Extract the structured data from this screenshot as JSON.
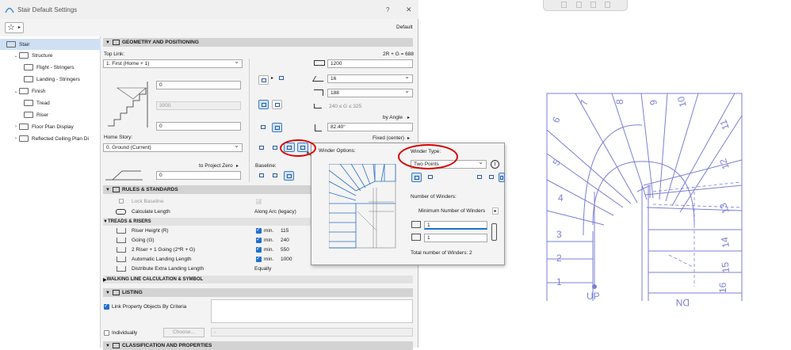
{
  "window": {
    "title": "Stair Default Settings",
    "help": "?",
    "close": "✕",
    "preset": "Default"
  },
  "tree": [
    {
      "label": "Stair",
      "level": 0,
      "selected": true,
      "arrow": ""
    },
    {
      "label": "Structure",
      "level": 1,
      "arrow": "v"
    },
    {
      "label": "Flight - Stringers",
      "level": 2,
      "arrow": ""
    },
    {
      "label": "Landing - Stringers",
      "level": 2,
      "arrow": ""
    },
    {
      "label": "Finish",
      "level": 1,
      "arrow": "v"
    },
    {
      "label": "Tread",
      "level": 2,
      "arrow": ""
    },
    {
      "label": "Riser",
      "level": 2,
      "arrow": ""
    },
    {
      "label": "Floor Plan Display",
      "level": 1,
      "arrow": ">"
    },
    {
      "label": "Reflected Ceiling Plan Di",
      "level": 1,
      "arrow": ">"
    }
  ],
  "geometry": {
    "header": "GEOMETRY AND POSITIONING",
    "formula": "2R + G = 688",
    "top_link_label": "Top Link:",
    "top_link_value": "1. First (Home + 1)",
    "offset_top": "0",
    "height": "3000",
    "offset_bottom": "0",
    "home_story_label": "Home Story:",
    "home_story_value": "0. Ground (Current)",
    "to_project_zero": "to Project Zero",
    "project_zero_value": "0",
    "width": "1200",
    "risers": "16",
    "riser_height": "188",
    "going_range": "240 ≤ G ≤ 325",
    "by_angle": "by Angle",
    "angle": "82.40°",
    "fixed_center": "Fixed (center)",
    "baseline_label": "Baseline:"
  },
  "winder_popup": {
    "options_label": "Winder Options:",
    "type_label": "Winder Type:",
    "type_value": "Two Points",
    "number_label": "Number of Winders:",
    "minimum_label": "Minimum Number of Winders",
    "value1": "1",
    "value2": "1",
    "total": "Total number of Winders: 2"
  },
  "rules": {
    "header": "RULES & STANDARDS",
    "lock_baseline": "Lock Baseline",
    "calculate_length": "Calculate Length",
    "calculate_length_value": "Along Arc (legacy)",
    "treads_header": "TREADS & RISERS",
    "rows": [
      {
        "label": "Riser Height (R)",
        "qual": "min.",
        "value": "115"
      },
      {
        "label": "Going (G)",
        "qual": "min.",
        "value": "240"
      },
      {
        "label": "2 Riser + 1 Going (2*R + G)",
        "qual": "min.",
        "value": "550"
      },
      {
        "label": "Automatic Landing Length",
        "qual": "min.",
        "value": "1000"
      },
      {
        "label": "Distribute Extra Landing Length",
        "qual": "",
        "value": "Equally"
      }
    ],
    "walking_header": "WALKING LINE CALCULATION & SYMBOL"
  },
  "listing": {
    "header": "LISTING",
    "link_criteria": "Link Property Objects By Criteria",
    "individually": "Individually",
    "choose": "Choose...",
    "dash": "-"
  },
  "classification": {
    "header": "CLASSIFICATION AND PROPERTIES"
  },
  "plan": {
    "color": "#7b7fd6",
    "numbers": [
      "1",
      "2",
      "3",
      "4",
      "5",
      "6",
      "7",
      "8",
      "9",
      "10",
      "11",
      "12",
      "13",
      "14",
      "15",
      "16"
    ],
    "up": "UP",
    "dn": "DN"
  },
  "colors": {
    "accent": "#1f6fd1",
    "highlight": "#d80000",
    "selection": "#cfe0f5"
  }
}
